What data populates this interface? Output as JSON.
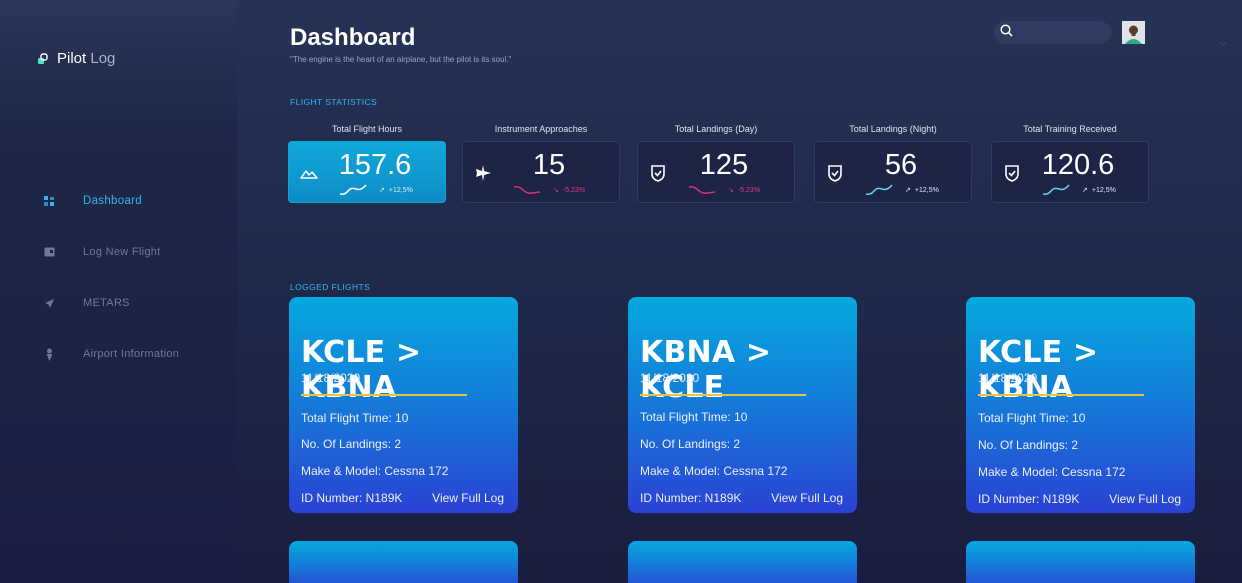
{
  "app": {
    "name_part1": "Pilot",
    "name_part2": "Log"
  },
  "nav": [
    {
      "label": "Dashboard",
      "icon": "grid-icon",
      "active": true
    },
    {
      "label": "Log New Flight",
      "icon": "logbook-icon",
      "active": false
    },
    {
      "label": "METARS",
      "icon": "paper-plane-icon",
      "active": false
    },
    {
      "label": "Airport Information",
      "icon": "location-pin-icon",
      "active": false
    }
  ],
  "header": {
    "title": "Dashboard",
    "quote": "\"The engine is the heart of an airplane, but the pilot is its soul.\""
  },
  "search": {
    "value": "",
    "placeholder": ""
  },
  "sections": {
    "stats": "FLIGHT STATISTICS",
    "flights": "LOGGED FLIGHTS"
  },
  "stats": [
    {
      "title": "Total Flight Hours",
      "value": "157.6",
      "change": "+12,5%",
      "trend": "up",
      "icon": "mountains-icon",
      "active": true
    },
    {
      "title": "Instrument Approaches",
      "value": "15",
      "change": "-5.23%",
      "trend": "down",
      "icon": "airplane-icon",
      "active": false
    },
    {
      "title": "Total Landings (Day)",
      "value": "125",
      "change": "-5.23%",
      "trend": "down",
      "icon": "shield-check-icon",
      "active": false
    },
    {
      "title": "Total Landings (Night)",
      "value": "56",
      "change": "+12,5%",
      "trend": "up",
      "icon": "shield-check-icon",
      "active": false
    },
    {
      "title": "Total Training Received",
      "value": "120.6",
      "change": "+12,5%",
      "trend": "up",
      "icon": "shield-check-icon",
      "active": false
    }
  ],
  "flights": [
    {
      "route": "KCLE > KBNA",
      "date": "11/18/2020",
      "flight_time": "Total Flight Time: 10",
      "landings": "No. Of Landings: 2",
      "make_model": "Make & Model: Cessna 172",
      "id_number": "ID Number: N189K",
      "link": "View Full Log"
    },
    {
      "route": "KBNA > KCLE",
      "date": "11/18/2020",
      "flight_time": "Total Flight Time: 10",
      "landings": "No. Of Landings: 2",
      "make_model": "Make & Model: Cessna 172",
      "id_number": "ID Number: N189K",
      "link": "View Full Log"
    },
    {
      "route": "KCLE > KBNA",
      "date": "11/18/2020",
      "flight_time": "Total Flight Time: 10",
      "landings": "No. Of Landings: 2",
      "make_model": "Make & Model: Cessna 172",
      "id_number": "ID Number: N189K",
      "link": "View Full Log"
    }
  ],
  "colors": {
    "accent": "#33b6ec",
    "underline": "#e8c53a",
    "negative": "#e23b7e"
  }
}
